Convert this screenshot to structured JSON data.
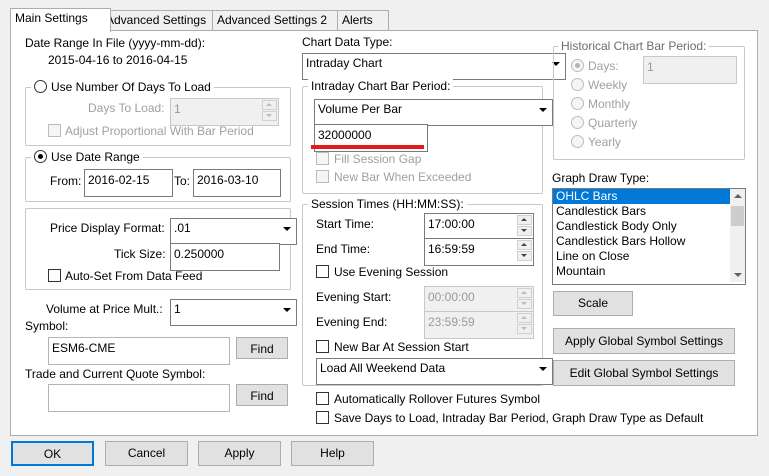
{
  "tabs": [
    "Main Settings",
    "Advanced Settings",
    "Advanced Settings 2",
    "Alerts"
  ],
  "date_range": {
    "label": "Date Range In File (yyyy-mm-dd):",
    "value": "2015-04-16 to 2016-04-15"
  },
  "days_to_load": {
    "radio_label": "Use Number Of Days To Load",
    "days_label": "Days To Load:",
    "days_value": "1",
    "adjust_label": "Adjust Proportional With Bar Period"
  },
  "date_range_group": {
    "radio_label": "Use Date Range",
    "from_label": "From:",
    "from_value": "2016-02-15",
    "to_label": "To:",
    "to_value": "2016-03-10"
  },
  "price": {
    "format_label": "Price Display Format:",
    "format_value": ".01",
    "tick_label": "Tick Size:",
    "tick_value": "0.250000",
    "autoset_label": "Auto-Set From Data Feed"
  },
  "volume": {
    "label": "Volume at Price Mult.:",
    "value": "1"
  },
  "symbol": {
    "label": "Symbol:",
    "value": "ESM6-CME",
    "find_label": "Find"
  },
  "trade_symbol": {
    "label": "Trade and Current Quote Symbol:",
    "value": "",
    "find_label": "Find"
  },
  "chart_data_type": {
    "label": "Chart Data Type:",
    "value": "Intraday Chart"
  },
  "intraday": {
    "title": "Intraday Chart Bar Period:",
    "type_value": "Volume Per Bar",
    "amount_value": "32000000",
    "fill_gap_label": "Fill Session Gap",
    "new_bar_label": "New Bar When Exceeded"
  },
  "session": {
    "title": "Session Times (HH:MM:SS):",
    "start_label": "Start Time:",
    "start_value": "17:00:00",
    "end_label": "End Time:",
    "end_value": "16:59:59",
    "evening_label": "Use Evening Session",
    "evening_start_label": "Evening Start:",
    "evening_start_value": "00:00:00",
    "evening_end_label": "Evening End:",
    "evening_end_value": "23:59:59",
    "new_bar_label": "New Bar At Session Start",
    "weekend_value": "Load All Weekend Data"
  },
  "rollover_label": "Automatically Rollover Futures Symbol",
  "save_default_label": "Save Days to Load, Intraday Bar Period, Graph Draw Type as Default",
  "historical": {
    "title": "Historical Chart Bar Period:",
    "days_label": "Days:",
    "days_value": "1",
    "weekly": "Weekly",
    "monthly": "Monthly",
    "quarterly": "Quarterly",
    "yearly": "Yearly"
  },
  "graph_draw": {
    "label": "Graph Draw Type:",
    "items": [
      "OHLC Bars",
      "Candlestick Bars",
      "Candlestick Body Only",
      "Candlestick Bars Hollow",
      "Line on Close",
      "Mountain"
    ],
    "selected": "OHLC Bars"
  },
  "buttons": {
    "scale": "Scale",
    "apply_global": "Apply Global Symbol Settings",
    "edit_global": "Edit Global Symbol Settings",
    "ok": "OK",
    "cancel": "Cancel",
    "apply": "Apply",
    "help": "Help"
  },
  "colors": {
    "selection": "#0078d7",
    "highlight_underline": "#e41a1a"
  }
}
